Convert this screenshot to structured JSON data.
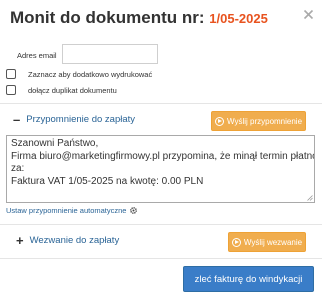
{
  "dialog": {
    "title": "Monit do dokumentu nr:",
    "document_number": "1/05-2025",
    "close_icon": "close-icon"
  },
  "form": {
    "email_label": "Adres email",
    "email_value": "",
    "email_placeholder": "",
    "checkbox_copy_label": "Zaznacz aby dodatkowo wydrukować",
    "checkbox_copy_checked": false,
    "checkbox_duplicate_label": "dołącz duplikat dokumentu",
    "checkbox_duplicate_checked": false
  },
  "reminder": {
    "toggle_symbol": "–",
    "title": "Przypomnienie do zapłaty",
    "send_button_label": "Wyślij przypomnienie",
    "message_lines": [
      "Szanowni Państwo,",
      "Firma biuro@marketingfirmowy.pl przypomina, że minął termin płatności",
      "za:",
      "Faktura VAT 1/05-2025 na kwotę: 0.00 PLN"
    ],
    "auto_link_label": "Ustaw przypomnienie automatyczne"
  },
  "demand": {
    "toggle_symbol": "+",
    "title": "Wezwanie do zapłaty",
    "send_button_label": "Wyślij wezwanie"
  },
  "footer": {
    "debt_collection_button_label": "zleć fakturę do windykacji"
  },
  "colors": {
    "accent_orange": "#f0ad4e",
    "doc_number_red": "#e8531f",
    "primary_blue": "#3a7dc8",
    "link_blue": "#2a6496"
  }
}
